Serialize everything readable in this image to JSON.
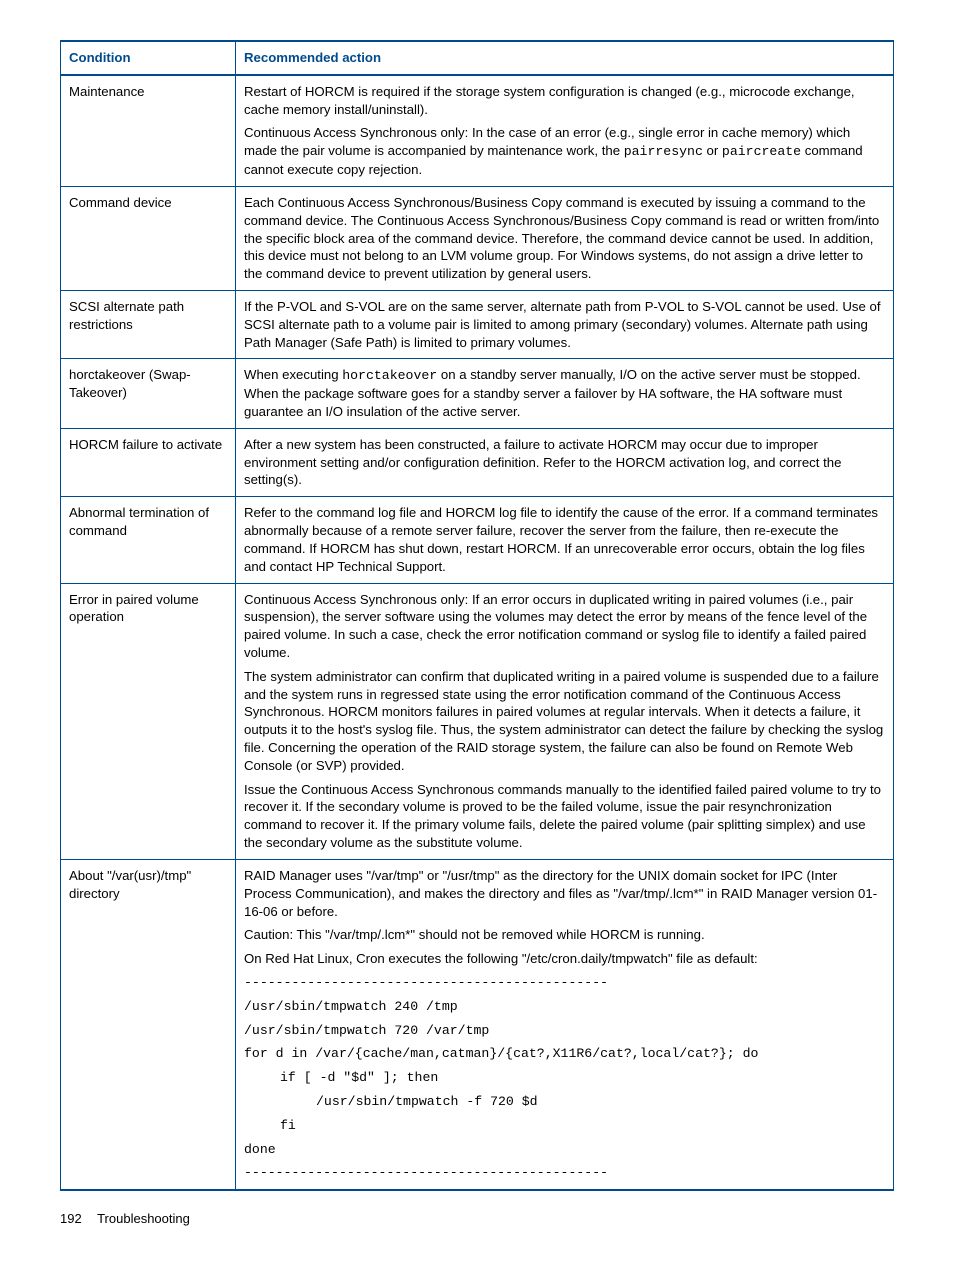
{
  "table": {
    "headers": [
      "Condition",
      "Recommended action"
    ],
    "rows": [
      {
        "condition": "Maintenance",
        "paras": [
          {
            "kind": "text",
            "text": "Restart of HORCM is required if the storage system configuration is changed (e.g., microcode exchange, cache memory install/uninstall)."
          },
          {
            "kind": "mixed",
            "segments": [
              {
                "t": "Continuous Access Synchronous only: In the case of an error (e.g., single error in cache memory) which made the pair volume is accompanied by maintenance work, the "
              },
              {
                "t": "pairresync",
                "mono": true
              },
              {
                "t": " or "
              },
              {
                "t": "paircreate",
                "mono": true
              },
              {
                "t": " command cannot execute copy rejection."
              }
            ]
          }
        ]
      },
      {
        "condition": "Command device",
        "paras": [
          {
            "kind": "text",
            "text": "Each Continuous Access Synchronous/Business Copy command is executed by issuing a command to the command device. The Continuous Access Synchronous/Business Copy command is read or written from/into the specific block area of the command device. Therefore, the command device cannot be used. In addition, this device must not belong to an LVM volume group. For Windows systems, do not assign a drive letter to the command device to prevent utilization by general users."
          }
        ]
      },
      {
        "condition": "SCSI alternate path restrictions",
        "paras": [
          {
            "kind": "text",
            "text": "If the P-VOL and S-VOL are on the same server, alternate path from P-VOL to S-VOL cannot be used. Use of SCSI alternate path to a volume pair is limited to among primary (secondary) volumes. Alternate path using Path Manager (Safe Path) is limited to primary volumes."
          }
        ]
      },
      {
        "condition": "horctakeover (Swap-Takeover)",
        "paras": [
          {
            "kind": "mixed",
            "segments": [
              {
                "t": "When executing "
              },
              {
                "t": "horctakeover",
                "mono": true
              },
              {
                "t": " on a standby server manually, I/O on the active server must be stopped. When the package software goes for a standby server a failover by HA software, the HA software must guarantee an I/O insulation of the active server."
              }
            ]
          }
        ]
      },
      {
        "condition": "HORCM failure to activate",
        "paras": [
          {
            "kind": "text",
            "text": "After a new system has been constructed, a failure to activate HORCM may occur due to improper environment setting and/or configuration definition. Refer to the HORCM activation log, and correct the setting(s)."
          }
        ]
      },
      {
        "condition": "Abnormal termination of command",
        "paras": [
          {
            "kind": "text",
            "text": "Refer to the command log file and HORCM log file to identify the cause of the error. If a command terminates abnormally because of a remote server failure, recover the server from the failure, then re-execute the command. If HORCM has shut down, restart HORCM. If an unrecoverable error occurs, obtain the log files and contact HP Technical Support."
          }
        ]
      },
      {
        "condition": "Error in paired volume operation",
        "paras": [
          {
            "kind": "text",
            "text": "Continuous Access Synchronous only: If an error occurs in duplicated writing in paired volumes (i.e., pair suspension), the server software using the volumes may detect the error by means of the fence level of the paired volume. In such a case, check the error notification command or syslog file to identify a failed paired volume."
          },
          {
            "kind": "text",
            "text": "The system administrator can confirm that duplicated writing in a paired volume is suspended due to a failure and the system runs in regressed state using the error notification command of the Continuous Access Synchronous. HORCM monitors failures in paired volumes at regular intervals. When it detects a failure, it outputs it to the host's syslog file. Thus, the system administrator can detect the failure by checking the syslog file. Concerning the operation of the RAID storage system, the failure can also be found on Remote Web Console (or SVP) provided."
          },
          {
            "kind": "text",
            "text": "Issue the Continuous Access Synchronous commands manually to the identified failed paired volume to try to recover it. If the secondary volume is proved to be the failed volume, issue the pair resynchronization command to recover it. If the primary volume fails, delete the paired volume (pair splitting simplex) and use the secondary volume as the substitute volume."
          }
        ]
      },
      {
        "condition": "About \"/var(usr)/tmp\" directory",
        "paras": [
          {
            "kind": "text",
            "text": "RAID Manager uses \"/var/tmp\" or \"/usr/tmp\" as the directory for the UNIX domain socket for IPC (Inter Process Communication), and makes the directory and files as \"/var/tmp/.lcm*\" in RAID Manager version 01-16-06 or before."
          },
          {
            "kind": "text",
            "text": "Caution: This \"/var/tmp/.lcm*\" should not be removed while HORCM is running."
          },
          {
            "kind": "text",
            "text": "On Red Hat Linux, Cron executes the following \"/etc/cron.daily/tmpwatch\" file as default:"
          },
          {
            "kind": "dash",
            "text": "----------------------------------------------"
          },
          {
            "kind": "mono",
            "text": "/usr/sbin/tmpwatch 240 /tmp"
          },
          {
            "kind": "mono",
            "text": "/usr/sbin/tmpwatch 720 /var/tmp"
          },
          {
            "kind": "mono",
            "text": "for d in /var/{cache/man,catman}/{cat?,X11R6/cat?,local/cat?}; do"
          },
          {
            "kind": "mono",
            "indent": 1,
            "text": "if [ -d \"$d\" ]; then"
          },
          {
            "kind": "mono",
            "indent": 2,
            "text": "/usr/sbin/tmpwatch -f 720 $d"
          },
          {
            "kind": "mono",
            "indent": 1,
            "text": "fi"
          },
          {
            "kind": "mono",
            "text": "done"
          },
          {
            "kind": "dash",
            "text": "----------------------------------------------"
          }
        ]
      }
    ]
  },
  "footer": {
    "page_number": "192",
    "section": "Troubleshooting"
  }
}
